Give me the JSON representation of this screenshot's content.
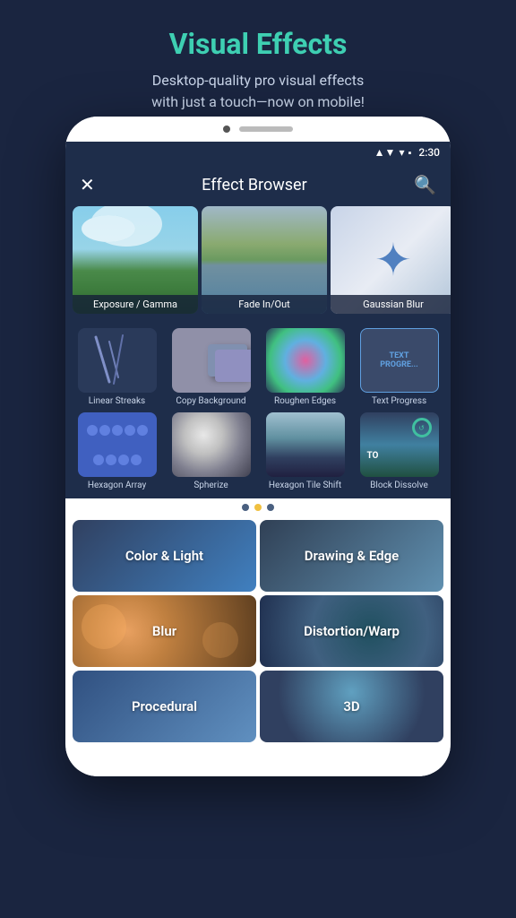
{
  "header": {
    "title": "Visual Effects",
    "subtitle": "Desktop-quality pro visual effects\nwith just a touch—now on mobile!"
  },
  "status_bar": {
    "time": "2:30"
  },
  "app": {
    "topbar_title": "Effect Browser",
    "close_label": "✕",
    "search_label": "🔍"
  },
  "featured_effects": [
    {
      "label": "Exposure / Gamma"
    },
    {
      "label": "Fade In/Out"
    },
    {
      "label": "Gaussian Blur"
    }
  ],
  "grid_effects_row1": [
    {
      "label": "Linear Streaks"
    },
    {
      "label": "Copy Background"
    },
    {
      "label": "Roughen Edges"
    },
    {
      "label": "Text Progress"
    }
  ],
  "grid_effects_row2": [
    {
      "label": "Hexagon Array"
    },
    {
      "label": "Spherize"
    },
    {
      "label": "Hexagon Tile Shift"
    },
    {
      "label": "Block Dissolve"
    }
  ],
  "pagination": {
    "dots": [
      false,
      true,
      false
    ]
  },
  "categories": [
    {
      "label": "Color & Light"
    },
    {
      "label": "Drawing & Edge"
    },
    {
      "label": "Blur"
    },
    {
      "label": "Distortion/Warp"
    },
    {
      "label": "Procedural"
    },
    {
      "label": "3D"
    }
  ]
}
